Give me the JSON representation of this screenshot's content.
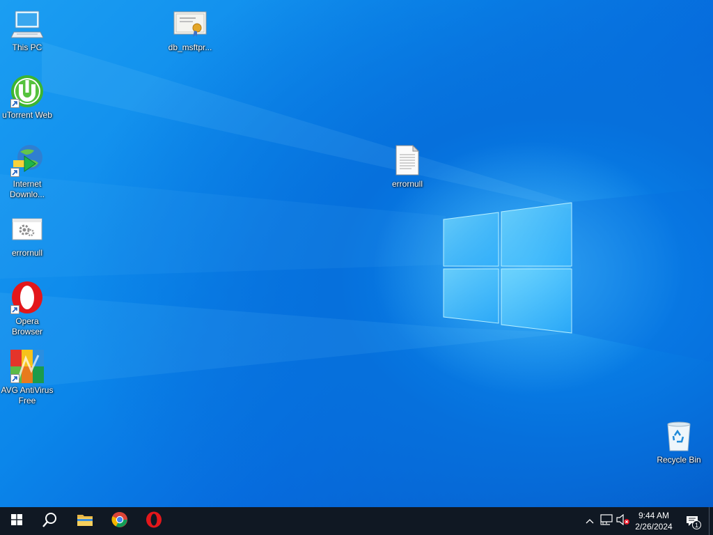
{
  "desktop": {
    "icons": [
      {
        "label": "This PC",
        "icon": "computer-icon"
      },
      {
        "label": "db_msftpr...",
        "icon": "certificate-icon"
      },
      {
        "label": "uTorrent Web",
        "icon": "utorrent-icon"
      },
      {
        "label": "Internet\nDownlo...",
        "icon": "internet-download-manager-icon"
      },
      {
        "label": "errornull",
        "icon": "settings-file-icon"
      },
      {
        "label": "errornull",
        "icon": "text-document-icon"
      },
      {
        "label": "Opera\nBrowser",
        "icon": "opera-icon"
      },
      {
        "label": "AVG AntiVirus\nFree",
        "icon": "avg-antivirus-icon"
      },
      {
        "label": "Recycle Bin",
        "icon": "recycle-bin-icon"
      }
    ]
  },
  "taskbar": {
    "buttons": [
      {
        "name": "start-button",
        "icon": "windows-logo-icon"
      },
      {
        "name": "search-button",
        "icon": "search-icon"
      },
      {
        "name": "file-explorer-button",
        "icon": "folder-icon"
      },
      {
        "name": "chrome-button",
        "icon": "chrome-icon"
      },
      {
        "name": "opera-button",
        "icon": "opera-icon"
      }
    ],
    "tray": {
      "chevron": "chevron-up-icon",
      "network": "network-icon",
      "volume": "volume-muted-icon",
      "time": "9:44 AM",
      "date": "2/26/2024",
      "notification_count": "1"
    }
  },
  "colors": {
    "taskbar": "#101823",
    "wallpaper_light": "#1b9ef2",
    "wallpaper_dark": "#0449b8"
  }
}
